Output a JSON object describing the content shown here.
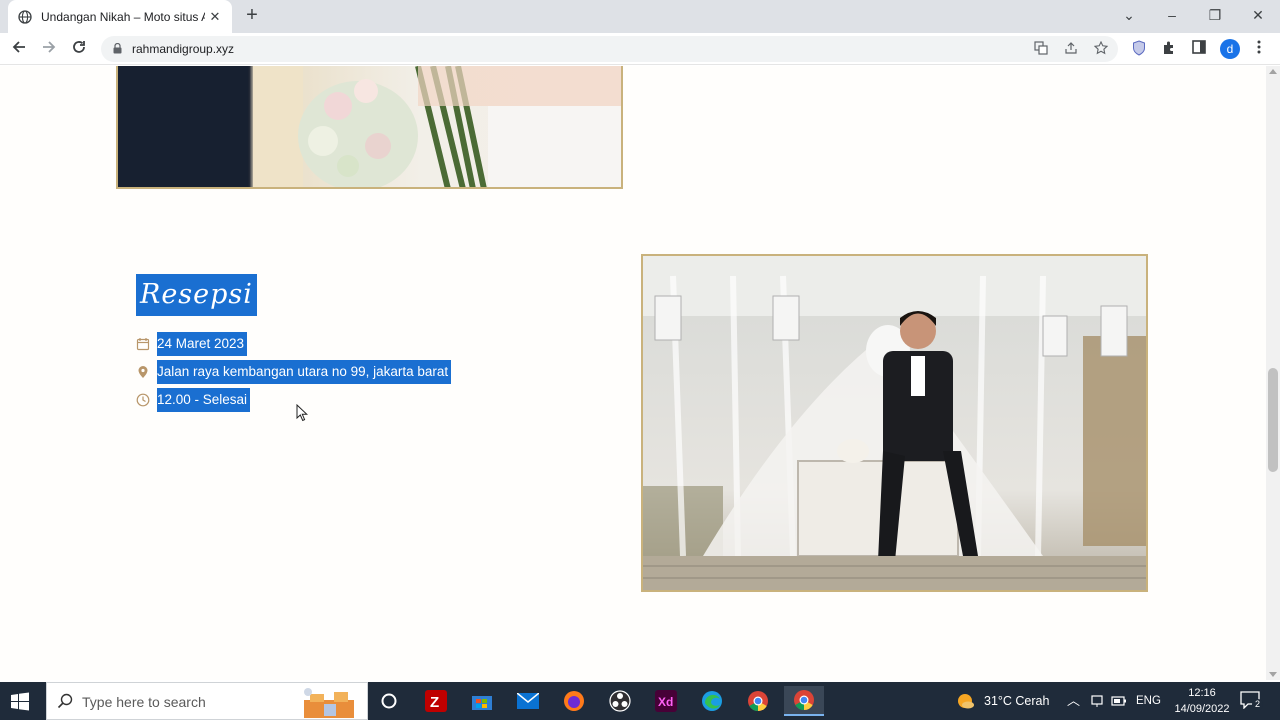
{
  "browser": {
    "tab_title": "Undangan Nikah – Moto situs Anda",
    "tab_close_glyph": "✕",
    "new_tab_glyph": "+",
    "url": "rahmandigroup.xyz",
    "avatar_letter": "d",
    "window_controls": {
      "dropdown": "⌄",
      "minimize": "–",
      "restore": "❐",
      "close": "✕"
    }
  },
  "reception": {
    "title": "Resepsi",
    "date": "24  Maret 2023",
    "address": "Jalan raya kembangan utara no 99, jakarta barat",
    "time": "12.00 - Selesai"
  },
  "taskbar": {
    "search_placeholder": "Type here to search",
    "weather": "31°C  Cerah",
    "language": "ENG",
    "time": "12:16",
    "date": "14/09/2022",
    "notification_count": "2"
  },
  "colors": {
    "selection": "#1a6fd1",
    "photo_border": "#c9b27c",
    "icon_gold": "#b8966a",
    "taskbar_bg": "#1f2b3a"
  }
}
